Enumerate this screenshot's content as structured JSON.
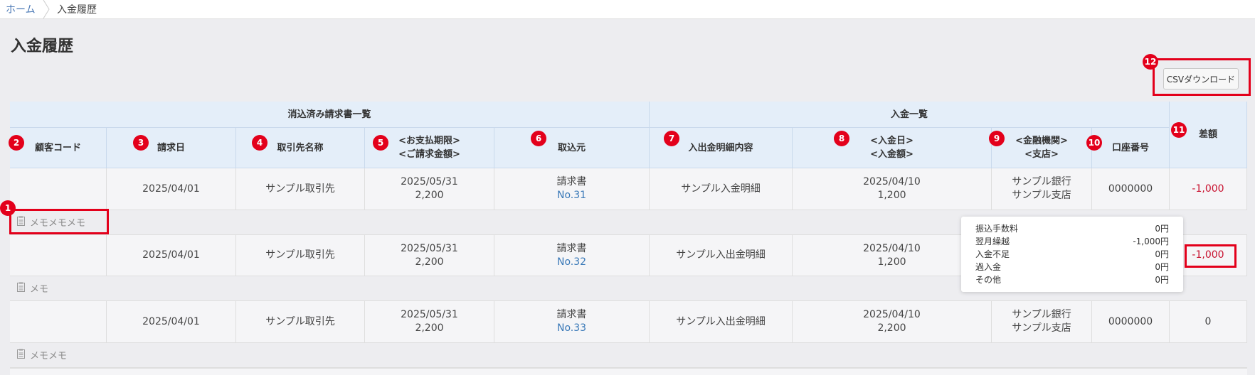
{
  "breadcrumb": {
    "home": "ホーム",
    "current": "入金履歴"
  },
  "page": {
    "title": "入金履歴"
  },
  "toolbar": {
    "csv_label": "CSVダウンロード"
  },
  "table": {
    "group_headers": {
      "invoices": "消込済み請求書一覧",
      "payments": "入金一覧"
    },
    "columns": {
      "customer_code": "顧客コード",
      "invoice_date": "請求日",
      "partner_name": "取引先名称",
      "due_amount_1": "<お支払期限>",
      "due_amount_2": "<ご請求金額>",
      "source": "取込元",
      "statement": "入出金明細内容",
      "pay_date_1": "<入金日>",
      "pay_date_2": "<入金額>",
      "bank_1": "<金融機関>",
      "bank_2": "<支店>",
      "account": "口座番号",
      "diff": "差額"
    },
    "rows": [
      {
        "customer_code": "",
        "invoice_date": "2025/04/01",
        "partner": "サンプル取引先",
        "due_date": "2025/05/31",
        "billed": "2,200",
        "source_label": "請求書",
        "source_link": "No.31",
        "statement": "サンプル入金明細",
        "pay_date": "2025/04/10",
        "pay_amount": "1,200",
        "bank": "サンプル銀行",
        "branch": "サンプル支店",
        "account": "0000000",
        "diff": "-1,000",
        "memo": "メモメモメモ"
      },
      {
        "customer_code": "",
        "invoice_date": "2025/04/01",
        "partner": "サンプル取引先",
        "due_date": "2025/05/31",
        "billed": "2,200",
        "source_label": "請求書",
        "source_link": "No.32",
        "statement": "サンプル入出金明細",
        "pay_date": "2025/04/10",
        "pay_amount": "1,200",
        "bank": "",
        "branch": "",
        "account": "",
        "diff": "-1,000",
        "memo": "メモ"
      },
      {
        "customer_code": "",
        "invoice_date": "2025/04/01",
        "partner": "サンプル取引先",
        "due_date": "2025/05/31",
        "billed": "2,200",
        "source_label": "請求書",
        "source_link": "No.33",
        "statement": "サンプル入出金明細",
        "pay_date": "2025/04/10",
        "pay_amount": "2,200",
        "bank": "サンプル銀行",
        "branch": "サンプル支店",
        "account": "0000000",
        "diff": "0",
        "memo": "メモメモ"
      }
    ]
  },
  "tooltip": {
    "items": [
      {
        "label": "振込手数料",
        "value": "0円"
      },
      {
        "label": "翌月繰越",
        "value": "-1,000円"
      },
      {
        "label": "入金不足",
        "value": "0円"
      },
      {
        "label": "過入金",
        "value": "0円"
      },
      {
        "label": "その他",
        "value": "0円"
      }
    ]
  },
  "annotations": [
    "1",
    "2",
    "3",
    "4",
    "5",
    "6",
    "7",
    "8",
    "9",
    "10",
    "11",
    "12"
  ],
  "colors": {
    "accent_red": "#e3001b",
    "link_blue": "#3a79b8",
    "header_bg": "#e4eef9",
    "negative": "#c8102e"
  }
}
